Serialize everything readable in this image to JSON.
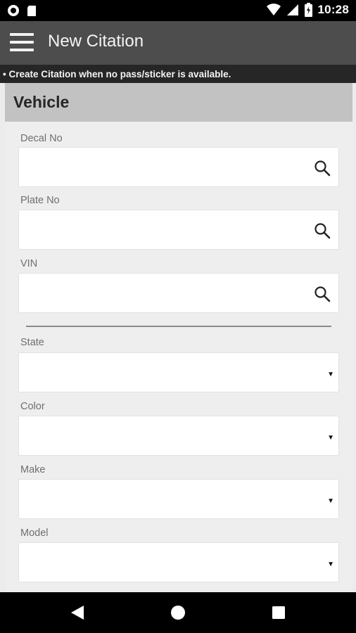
{
  "status_bar": {
    "time": "10:28",
    "left_icons": [
      "record-icon",
      "sd-card-icon"
    ],
    "right_icons": [
      "wifi-icon",
      "signal-icon",
      "battery-icon"
    ]
  },
  "app_bar": {
    "title": "New Citation",
    "menu_icon": "hamburger-menu-icon"
  },
  "notice": "• Create Citation when no pass/sticker is available.",
  "section": {
    "title": "Vehicle"
  },
  "search_fields": [
    {
      "label": "Decal No",
      "value": ""
    },
    {
      "label": "Plate No",
      "value": ""
    },
    {
      "label": "VIN",
      "value": ""
    }
  ],
  "select_fields": [
    {
      "label": "State",
      "value": ""
    },
    {
      "label": "Color",
      "value": ""
    },
    {
      "label": "Make",
      "value": ""
    },
    {
      "label": "Model",
      "value": ""
    }
  ],
  "nav_bar": {
    "buttons": [
      "back-icon",
      "home-icon",
      "recents-icon"
    ]
  },
  "colors": {
    "app_bar": "#4d4d4d",
    "notice_bar": "#262626",
    "section_header": "#c2c2c2",
    "form_background": "#eeeeee"
  }
}
